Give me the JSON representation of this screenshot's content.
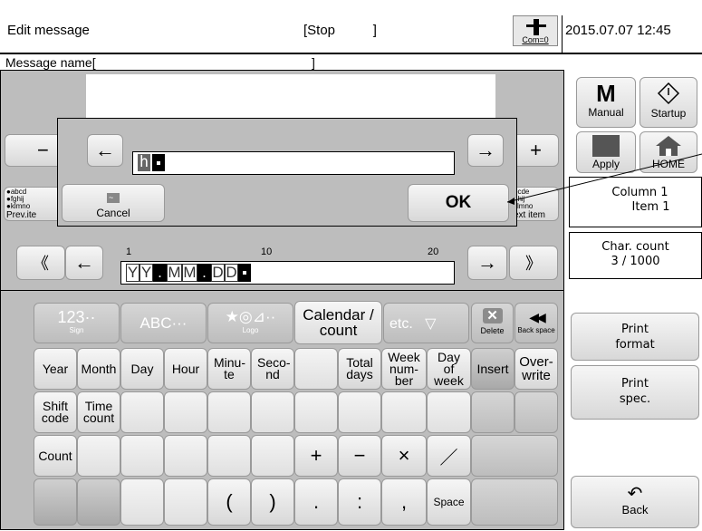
{
  "header": {
    "title": "Edit message",
    "status": "[Stop          ]",
    "com_label": "Com=0",
    "datetime": "2015.07.07 12:45"
  },
  "message_name": {
    "label": "Message name[",
    "close": "]"
  },
  "dialog": {
    "left_arrow": "←",
    "right_arrow": "→",
    "value_char": "h",
    "cancel_label": "Cancel",
    "ok_label": "OK"
  },
  "nav": {
    "minus": "−",
    "plus": "+",
    "prev_label": "Prev.ite",
    "next_label": "ext item",
    "prev_lines": [
      "●abcd",
      "●fghij",
      "●klmno"
    ],
    "next_lines": [
      "bcde",
      "ghij",
      "klmno"
    ],
    "double_left": "《",
    "double_right": "》",
    "left_arrow": "←",
    "right_arrow": "→"
  },
  "ruler": {
    "t1": "1",
    "t10": "10",
    "t20": "20"
  },
  "date_tokens": [
    "Y",
    "Y",
    ".",
    "M",
    "M",
    ".",
    "D",
    "D"
  ],
  "side": {
    "manual_big": "M",
    "manual_label": "Manual",
    "startup_label": "Startup",
    "apply_label": "Apply",
    "home_label": "HOME",
    "column": "Column 1",
    "item": "Item 1",
    "count_title": "Char. count",
    "count_value": "3 / 1000",
    "print_format": "Print format",
    "print_spec": "Print spec.",
    "back_label": "Back"
  },
  "tabs": {
    "sign_top": "123··",
    "sign_sub": "Sign",
    "abc": "ABC···",
    "logo_top": "★◎⊿··",
    "logo_sub": "Logo",
    "calendar": "Calendar / count",
    "etc": "etc.   ▽",
    "delete_label": "Delete",
    "backspace_label": "Back space"
  },
  "keys": {
    "year": "Year",
    "month": "Month",
    "day": "Day",
    "hour": "Hour",
    "minute": "Minu-te",
    "second": "Seco-nd",
    "total_days": "Total days",
    "week_number": "Week num-ber",
    "day_of_week": "Day of week",
    "insert": "Insert",
    "overwrite": "Over-write",
    "shift_code": "Shift code",
    "time_count": "Time count",
    "count": "Count",
    "plus": "+",
    "minus": "−",
    "times": "×",
    "slash": "／",
    "lparen": "(",
    "rparen": ")",
    "dot": ".",
    "colon": ":",
    "comma": ",",
    "space": "Space"
  }
}
